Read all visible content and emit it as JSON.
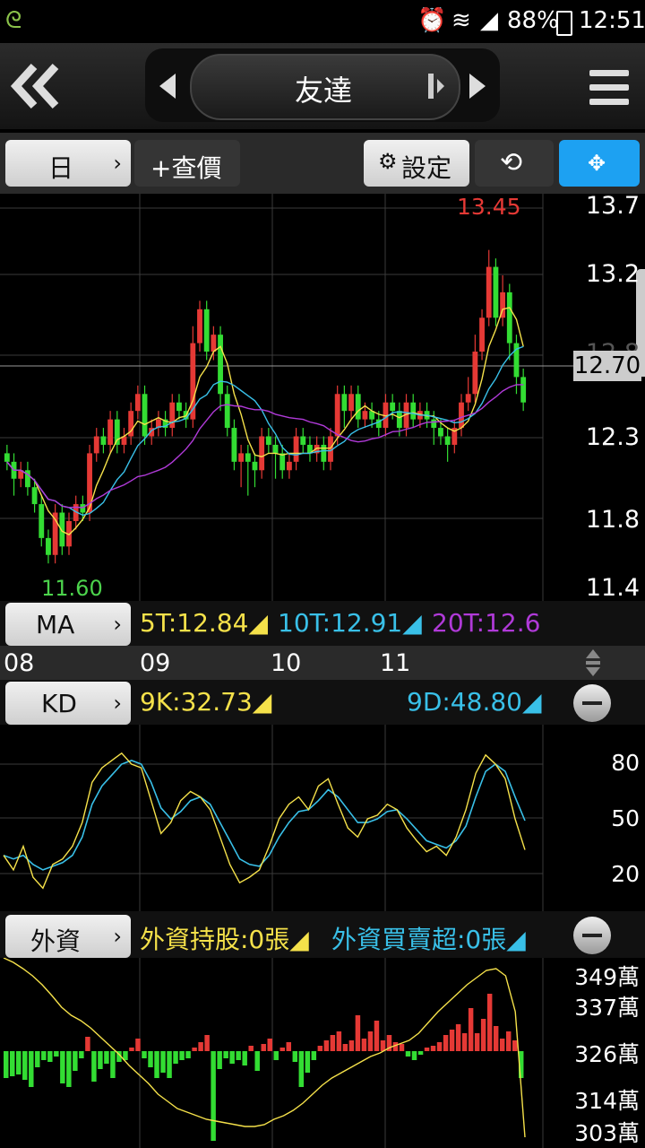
{
  "status_bar": {
    "battery": "88%",
    "time": "12:51"
  },
  "header": {
    "title": "友達"
  },
  "toolbar": {
    "period": "日",
    "lookup": "+查價",
    "settings": "設定"
  },
  "price_axis": {
    "labels": [
      "13.7",
      "13.2",
      "12.8",
      "12.3",
      "11.8",
      "11.4"
    ],
    "current": "12.70"
  },
  "chart_annotations": {
    "high": "13.45",
    "low": "11.60"
  },
  "ma": {
    "label": "MA",
    "t5": "5T:12.84",
    "t10": "10T:12.91",
    "t20": "20T:12.6",
    "colors": {
      "t5": "#f5e14a",
      "t10": "#39c0e8",
      "t20": "#b03ad8"
    }
  },
  "date_axis": {
    "labels": [
      "08",
      "09",
      "10",
      "11"
    ]
  },
  "kd": {
    "label": "KD",
    "k": "9K:32.73",
    "d": "9D:48.80",
    "levels": [
      "80",
      "50",
      "20"
    ]
  },
  "foreign": {
    "label": "外資",
    "holding": "外資持股:0張",
    "net": "外資買賣超:0張",
    "levels": [
      "349萬",
      "337萬",
      "326萬",
      "314萬",
      "303萬"
    ]
  },
  "chart_data": {
    "type": "candlestick",
    "ylim": [
      11.4,
      13.75
    ],
    "candles": [
      [
        12.25,
        12.2,
        12.3,
        12.15
      ],
      [
        12.2,
        12.1,
        12.25,
        12.0
      ],
      [
        12.1,
        12.15,
        12.2,
        12.05
      ],
      [
        12.15,
        12.05,
        12.2,
        12.0
      ],
      [
        12.05,
        11.95,
        12.1,
        11.9
      ],
      [
        11.95,
        11.75,
        12.0,
        11.7
      ],
      [
        11.75,
        11.65,
        11.8,
        11.6
      ],
      [
        11.65,
        11.9,
        11.95,
        11.6
      ],
      [
        11.9,
        11.7,
        11.95,
        11.65
      ],
      [
        11.7,
        11.85,
        11.9,
        11.65
      ],
      [
        11.85,
        11.95,
        12.0,
        11.8
      ],
      [
        11.95,
        11.9,
        12.0,
        11.85
      ],
      [
        11.9,
        12.25,
        12.3,
        11.85
      ],
      [
        12.25,
        12.35,
        12.4,
        12.2
      ],
      [
        12.35,
        12.3,
        12.4,
        12.25
      ],
      [
        12.3,
        12.45,
        12.5,
        12.25
      ],
      [
        12.45,
        12.3,
        12.5,
        12.25
      ],
      [
        12.3,
        12.35,
        12.4,
        12.25
      ],
      [
        12.35,
        12.5,
        12.55,
        12.3
      ],
      [
        12.5,
        12.6,
        12.65,
        12.45
      ],
      [
        12.6,
        12.35,
        12.65,
        12.3
      ],
      [
        12.35,
        12.4,
        12.45,
        12.3
      ],
      [
        12.4,
        12.45,
        12.5,
        12.35
      ],
      [
        12.45,
        12.4,
        12.5,
        12.35
      ],
      [
        12.4,
        12.55,
        12.6,
        12.35
      ],
      [
        12.55,
        12.5,
        12.6,
        12.45
      ],
      [
        12.5,
        12.45,
        12.55,
        12.4
      ],
      [
        12.45,
        12.9,
        13.0,
        12.4
      ],
      [
        12.9,
        13.1,
        13.15,
        12.85
      ],
      [
        13.1,
        12.85,
        13.15,
        12.8
      ],
      [
        12.85,
        12.95,
        13.0,
        12.8
      ],
      [
        12.95,
        12.6,
        13.0,
        12.5
      ],
      [
        12.6,
        12.4,
        12.65,
        12.35
      ],
      [
        12.4,
        12.2,
        12.45,
        12.15
      ],
      [
        12.2,
        12.25,
        12.3,
        12.05
      ],
      [
        12.25,
        12.2,
        12.3,
        12.0
      ],
      [
        12.2,
        12.15,
        12.25,
        12.05
      ],
      [
        12.15,
        12.35,
        12.4,
        12.1
      ],
      [
        12.35,
        12.3,
        12.4,
        12.25
      ],
      [
        12.3,
        12.25,
        12.35,
        12.1
      ],
      [
        12.25,
        12.15,
        12.3,
        12.1
      ],
      [
        12.15,
        12.2,
        12.25,
        12.1
      ],
      [
        12.2,
        12.35,
        12.4,
        12.15
      ],
      [
        12.35,
        12.3,
        12.4,
        12.25
      ],
      [
        12.3,
        12.25,
        12.35,
        12.2
      ],
      [
        12.25,
        12.3,
        12.35,
        12.2
      ],
      [
        12.3,
        12.2,
        12.35,
        12.15
      ],
      [
        12.2,
        12.35,
        12.4,
        12.15
      ],
      [
        12.35,
        12.6,
        12.65,
        12.3
      ],
      [
        12.6,
        12.5,
        12.65,
        12.4
      ],
      [
        12.5,
        12.6,
        12.65,
        12.45
      ],
      [
        12.6,
        12.45,
        12.65,
        12.4
      ],
      [
        12.45,
        12.5,
        12.55,
        12.4
      ],
      [
        12.5,
        12.45,
        12.55,
        12.4
      ],
      [
        12.45,
        12.4,
        12.5,
        12.35
      ],
      [
        12.4,
        12.55,
        12.6,
        12.35
      ],
      [
        12.55,
        12.5,
        12.6,
        12.45
      ],
      [
        12.5,
        12.4,
        12.55,
        12.35
      ],
      [
        12.4,
        12.55,
        12.6,
        12.35
      ],
      [
        12.55,
        12.45,
        12.6,
        12.4
      ],
      [
        12.45,
        12.5,
        12.55,
        12.4
      ],
      [
        12.5,
        12.45,
        12.55,
        12.4
      ],
      [
        12.45,
        12.4,
        12.5,
        12.3
      ],
      [
        12.4,
        12.35,
        12.45,
        12.3
      ],
      [
        12.35,
        12.3,
        12.4,
        12.2
      ],
      [
        12.3,
        12.4,
        12.45,
        12.25
      ],
      [
        12.4,
        12.55,
        12.6,
        12.35
      ],
      [
        12.55,
        12.6,
        12.7,
        12.5
      ],
      [
        12.6,
        12.85,
        12.95,
        12.55
      ],
      [
        12.85,
        13.05,
        13.1,
        12.8
      ],
      [
        13.05,
        13.35,
        13.45,
        13.0
      ],
      [
        13.35,
        13.05,
        13.4,
        13.0
      ],
      [
        13.05,
        13.2,
        13.3,
        13.0
      ],
      [
        13.2,
        12.9,
        13.25,
        12.8
      ],
      [
        12.9,
        12.7,
        12.95,
        12.6
      ],
      [
        12.7,
        12.55,
        12.75,
        12.5
      ]
    ]
  }
}
